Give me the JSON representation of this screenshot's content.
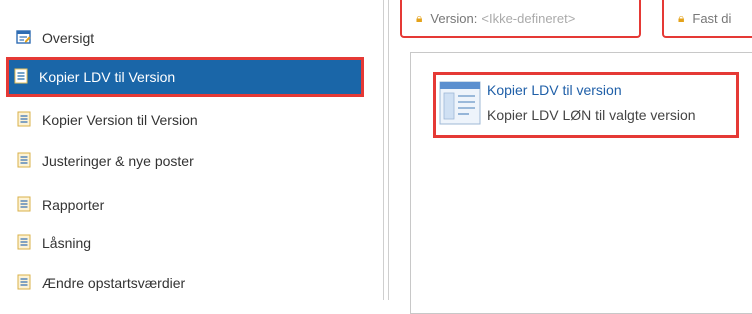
{
  "sidebar": {
    "items": [
      {
        "label": "Oversigt",
        "icon": "edit-list-icon",
        "active": false
      },
      {
        "label": "Kopier LDV til Version",
        "icon": "document-icon",
        "active": true
      },
      {
        "label": "Kopier Version til Version",
        "icon": "document-icon",
        "active": false
      },
      {
        "label": "Justeringer & nye poster",
        "icon": "document-icon",
        "active": false
      },
      {
        "label": "Rapporter",
        "icon": "document-icon",
        "active": false
      },
      {
        "label": "Låsning",
        "icon": "document-icon",
        "active": false
      },
      {
        "label": "Ændre opstartsværdier",
        "icon": "document-icon",
        "active": false
      }
    ]
  },
  "status": {
    "version_label": "Version:",
    "version_value": "<Ikke-defineret>",
    "fixed_label": "Fast di"
  },
  "tile": {
    "title": "Kopier LDV til version",
    "subtitle": "Kopier LDV LØN til valgte version",
    "icon": "window-form-icon"
  },
  "colors": {
    "active_bg": "#1a66a8",
    "highlight": "#e53935",
    "link": "#1f5fa8",
    "lock": "#e4a21a"
  }
}
